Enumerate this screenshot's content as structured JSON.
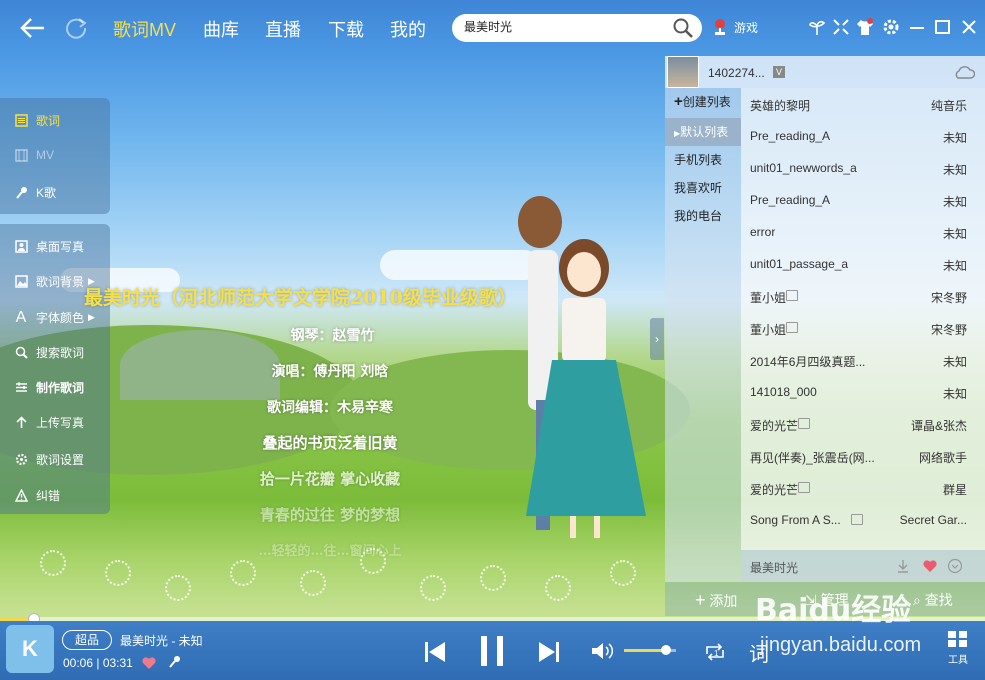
{
  "nav": {
    "tabs": [
      "歌词MV",
      "曲库",
      "直播",
      "下载",
      "我的"
    ],
    "active": "歌词MV"
  },
  "search": {
    "value": "最美时光"
  },
  "game_label": "游戏",
  "left_panel": {
    "group1": [
      "歌词",
      "MV",
      "K歌"
    ],
    "group2": [
      "桌面写真",
      "歌词背景",
      "字体颜色",
      "搜索歌词",
      "制作歌词",
      "上传写真",
      "歌词设置",
      "纠错"
    ]
  },
  "lyrics": {
    "title": "最美时光（河北师范大学文学院2010级毕业级歌）",
    "lines": [
      "钢琴：赵雪竹",
      "演唱：傅丹阳 刘晗",
      "歌词编辑：木易辛寒",
      "叠起的书页泛着旧黄",
      "拾一片花瓣 掌心收藏",
      "青春的过往 梦的梦想",
      "…轻轻的…往…窗间心上"
    ]
  },
  "user": {
    "name": "1402274...",
    "vip_badge": "V"
  },
  "playlist_nav": {
    "create": "创建列表",
    "items": [
      "默认列表",
      "手机列表",
      "我喜欢听",
      "我的电台"
    ],
    "selected": "默认列表"
  },
  "songs": [
    {
      "title": "英雄的黎明",
      "artist": "纯音乐",
      "mv": false
    },
    {
      "title": "Pre_reading_A",
      "artist": "未知",
      "mv": false
    },
    {
      "title": "unit01_newwords_a",
      "artist": "未知",
      "mv": false
    },
    {
      "title": "Pre_reading_A",
      "artist": "未知",
      "mv": false
    },
    {
      "title": "error",
      "artist": "未知",
      "mv": false
    },
    {
      "title": "unit01_passage_a",
      "artist": "未知",
      "mv": false
    },
    {
      "title": "董小姐",
      "artist": "宋冬野",
      "mv": true
    },
    {
      "title": "董小姐",
      "artist": "宋冬野",
      "mv": true
    },
    {
      "title": "2014年6月四级真题...",
      "artist": "未知",
      "mv": false
    },
    {
      "title": "141018_000",
      "artist": "未知",
      "mv": false
    },
    {
      "title": "爱的光芒",
      "artist": "谭晶&张杰",
      "mv": true
    },
    {
      "title": "再见(伴奏)_张震岳(网...",
      "artist": "网络歌手",
      "mv": false
    },
    {
      "title": "爱的光芒",
      "artist": "群星",
      "mv": true
    },
    {
      "title": "Song From A S...",
      "artist": "Secret Gar...",
      "mv": true
    }
  ],
  "now_playing_row": "最美时光",
  "list_footer": {
    "add": "添加",
    "manage": "管理",
    "find": "查找"
  },
  "player": {
    "quality": "超品",
    "now": "最美时光 - 未知",
    "elapsed": "00:06",
    "total": "03:31",
    "progress": 0.03,
    "volume": 0.8,
    "lyric_btn": "词",
    "tools": "工具",
    "logo": "K"
  },
  "watermark": {
    "line1": "Baidu经验",
    "line2": "jingyan.baidu.com"
  },
  "colors": {
    "accent": "#f7e14a",
    "bar": "#2f6cb4"
  }
}
